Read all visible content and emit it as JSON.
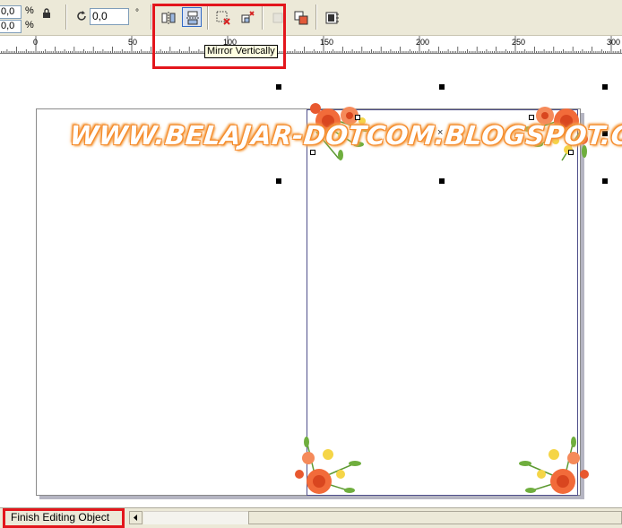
{
  "toolbar": {
    "width_scale": "0,0",
    "width_unit": "%",
    "height_scale": "0,0",
    "height_unit": "%",
    "rotation_value": "0,0",
    "rotation_unit": "°"
  },
  "tooltip": "Mirror Vertically",
  "ruler": {
    "ticks": [
      "0",
      "50",
      "100",
      "150",
      "200",
      "250",
      "300"
    ]
  },
  "canvas": {
    "watermark": "WWW.BELAJAR-DOTCOM.BLOGSPOT.COM",
    "center_mark": "×"
  },
  "statusbar": {
    "finish_label": "Finish Editing Object"
  },
  "colors": {
    "highlight": "#e3161c",
    "watermark_outline": "#f58a2a",
    "flower_orange": "#f26b3a",
    "flower_yellow": "#f5d547",
    "leaf_green": "#6fae3e",
    "page_border": "#4f4f8a"
  }
}
